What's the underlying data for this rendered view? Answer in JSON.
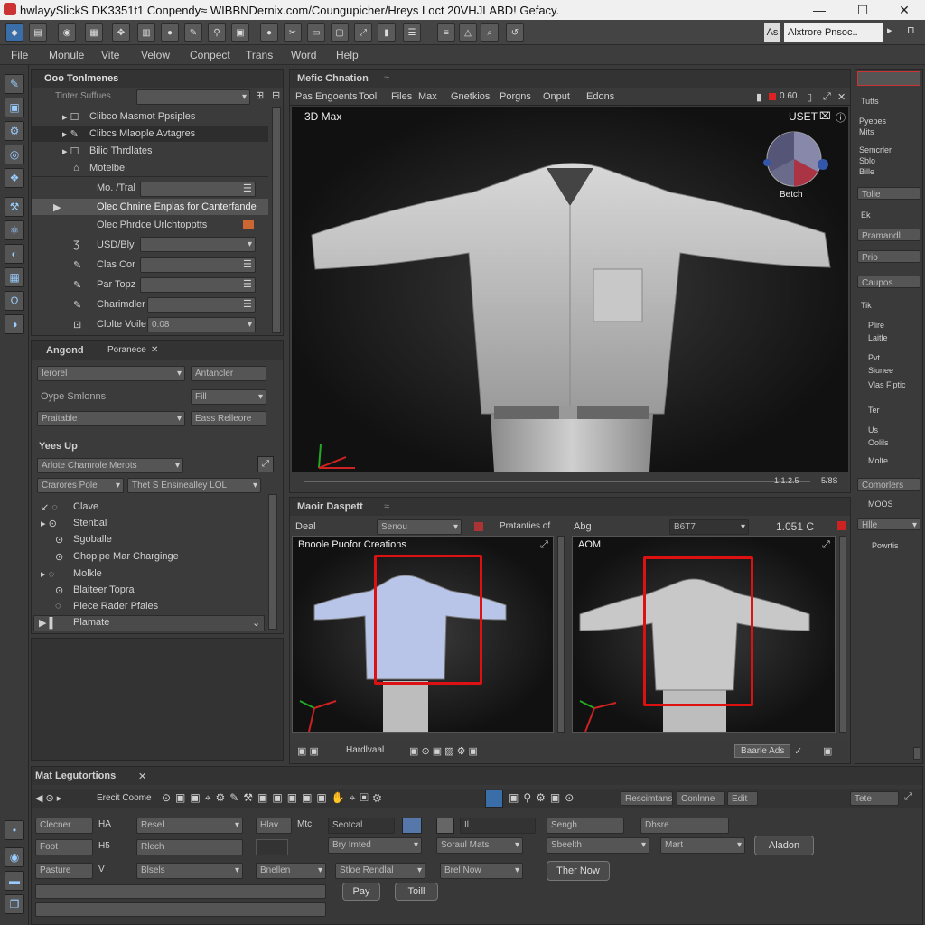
{
  "window": {
    "title": "hwlayySlickS DK3351t1 Conpendy≈ WIBBNDernix.com/Coungupicher/Hreys Loct 20VHJLABD! Gefacy.",
    "min": "—",
    "max": "☐",
    "close": "✕"
  },
  "toolbar": {
    "search_text": "Alxtrore Pnsoc..",
    "search_prefix": "As"
  },
  "menu": [
    "File",
    "Monule",
    "Vite",
    "Velow",
    "Conpect",
    "Trans",
    "Word",
    "Help"
  ],
  "left_panel": {
    "title": "Ooo Tonlmenes",
    "filter_label": "Tinter Suffues",
    "tree": [
      "Clibco Masmot Ppsiples",
      "Clibcs Mlaople Avtagres",
      "Bilio Thrdlates",
      "Motelbe"
    ],
    "rows": [
      {
        "label": "Mo. /Tral",
        "value": ""
      },
      {
        "label": "Olec Chnine Enplas for Canterfande",
        "value": ""
      },
      {
        "label": "Olec Phrdce Urlchtopptts",
        "value": ""
      },
      {
        "label": "USD/Bly",
        "value": ""
      },
      {
        "label": "Clas Cor",
        "value": ""
      },
      {
        "label": "Par Topz",
        "value": ""
      },
      {
        "label": "Charimdler",
        "value": ""
      },
      {
        "label": "Clolte Voile",
        "value": "0.08"
      }
    ]
  },
  "mid_panel": {
    "tabs": [
      "Angond",
      "Poranece"
    ],
    "f1": "Ierorel",
    "f2": "Antancler",
    "label1": "Oype Smlonns",
    "f3": "Fill",
    "f4": "Praitable",
    "f5": "Eass Relleore",
    "section": "Yees Up",
    "f6": "Arlote Chamrole Merots",
    "f7": "Crarores Pole",
    "f8": "Thet S Ensinealley LOL",
    "items": [
      "Clave",
      "Stenbal",
      "Sgoballe",
      "Chopipe Mar Charginge",
      "Molkle",
      "Blaiteer Topra",
      "Plece Rader Pfales",
      "Plamate"
    ]
  },
  "viewport": {
    "title": "Mefic Chnation",
    "tabs": [
      "Pas Engoents",
      "Tool",
      "Files",
      "Max",
      "Gnetkios",
      "Porgns",
      "Onput",
      "Edons"
    ],
    "label": "3D Max",
    "view": "USET",
    "zoom": "0.60",
    "status": "1:1.2.5",
    "status2": "5/8S",
    "gizmo_label": "Betch"
  },
  "bottom_view": {
    "title": "Maoir Daspett",
    "deal": "Deal",
    "select": "Senou",
    "label_mid": "Pratanties of",
    "label_abs": "Abg",
    "field": "B6T7",
    "value": "1.051 C",
    "left_title": "Bnoole Puofor Creations",
    "right_title": "AOM",
    "btn1": "Hardlvaal",
    "btn2": "Baarle Ads"
  },
  "right_panel": {
    "items": [
      "Tutts",
      "Pyepes",
      "Mits",
      "Semcrler",
      "Sblo",
      "Bille",
      "Tolie",
      "Ek",
      "Pramandl",
      "Prio",
      "Caupos",
      "Tik",
      "Plire",
      "Laitle",
      "Pvt",
      "Siunee",
      "Vlas Flptic",
      "Ter",
      "Us",
      "Oolils",
      "Molte",
      "Comorlers",
      "MOOS",
      "Hlle",
      "Powrtis"
    ]
  },
  "bottom_panel": {
    "title": "Mat Legutortions",
    "tool_label": "Erecit Coome",
    "chip1": "Rescimtans",
    "chip2": "Conlnne",
    "chip3": "Edit",
    "chip4": "Tete",
    "r1": [
      "Clecner",
      "HA",
      "Resel",
      "Hlav",
      "Mtc",
      "Seotcal",
      "Il",
      "Sengh",
      "Dhsre"
    ],
    "r2": [
      "Foot",
      "H5",
      "Rlech",
      "Bry Imted",
      "Soraul Mats",
      "Sbeelth",
      "Mart",
      "Aladon"
    ],
    "r3": [
      "Pasture",
      "V",
      "Blsels",
      "Bnellen",
      "Stloe Rendlal",
      "Brel Now",
      "Ther Now"
    ],
    "pay": "Pay",
    "tool": "Toill"
  }
}
